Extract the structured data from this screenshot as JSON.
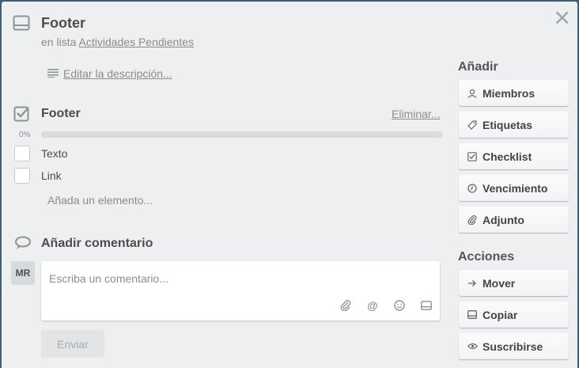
{
  "card": {
    "title": "Footer",
    "list_prefix": "en lista",
    "list_name": "Actividades Pendientes",
    "edit_description": "Editar la descripción..."
  },
  "checklist": {
    "title": "Footer",
    "delete_label": "Eliminar...",
    "progress_label": "0%",
    "progress": 0,
    "items": [
      {
        "label": "Texto",
        "checked": false
      },
      {
        "label": "Link",
        "checked": false
      }
    ],
    "add_item": "Añada un elemento..."
  },
  "comment": {
    "title": "Añadir comentario",
    "avatar_initials": "MR",
    "placeholder": "Escriba un comentario...",
    "send_label": "Enviar"
  },
  "sidebar": {
    "add_heading": "Añadir",
    "add_buttons": [
      {
        "label": "Miembros",
        "icon": "person-icon"
      },
      {
        "label": "Etiquetas",
        "icon": "tag-icon"
      },
      {
        "label": "Checklist",
        "icon": "checklist-icon"
      },
      {
        "label": "Vencimiento",
        "icon": "clock-icon"
      },
      {
        "label": "Adjunto",
        "icon": "paperclip-icon"
      }
    ],
    "actions_heading": "Acciones",
    "action_buttons": [
      {
        "label": "Mover",
        "icon": "arrow-right-icon"
      },
      {
        "label": "Copiar",
        "icon": "card-icon"
      },
      {
        "label": "Suscribirse",
        "icon": "eye-icon"
      }
    ]
  },
  "colors": {
    "progress_fill": "#5ba4cf",
    "window_bg": "#edeff0"
  }
}
